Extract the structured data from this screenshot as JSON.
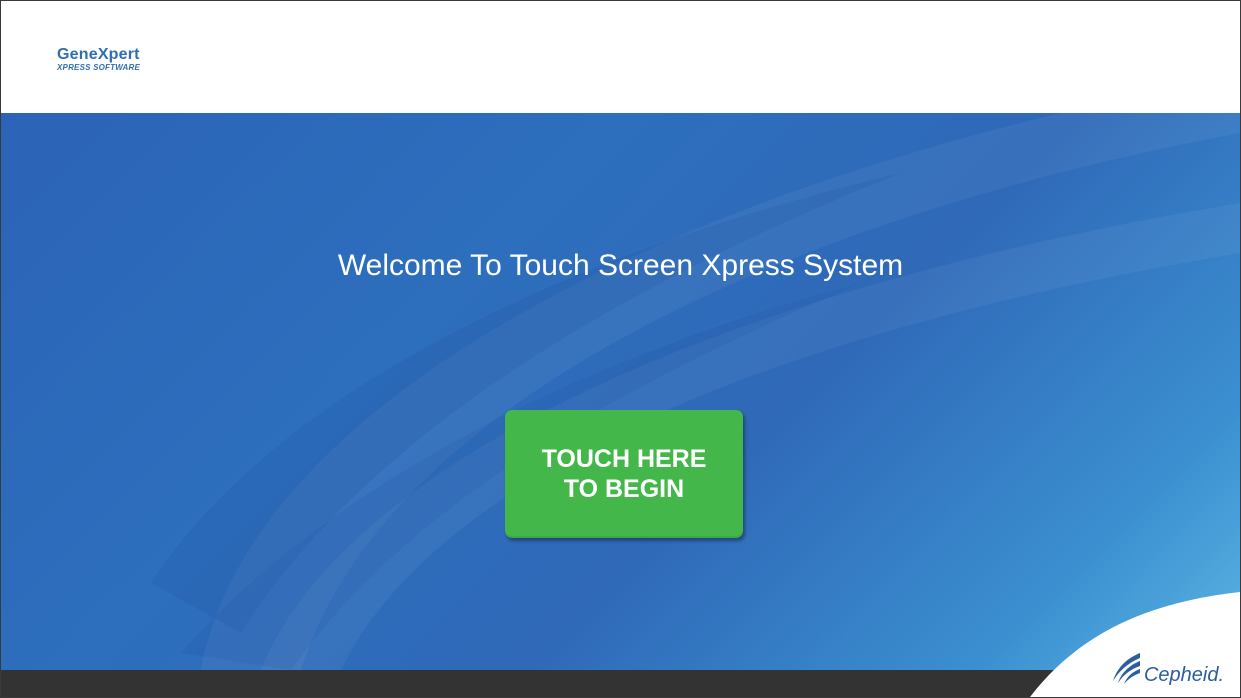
{
  "header": {
    "logo_main": "GeneXpert",
    "logo_sub": "XPRESS SOFTWARE"
  },
  "main": {
    "welcome": "Welcome To Touch Screen Xpress System",
    "begin_button_label": "TOUCH HERE\nTO BEGIN"
  },
  "footer": {
    "brand": "Cepheid."
  },
  "colors": {
    "brand_blue": "#2f6fb0",
    "button_green": "#44b74a",
    "footer_dark": "#333333"
  },
  "icons": {
    "brand_mark": "cepheid-swoosh-icon"
  }
}
